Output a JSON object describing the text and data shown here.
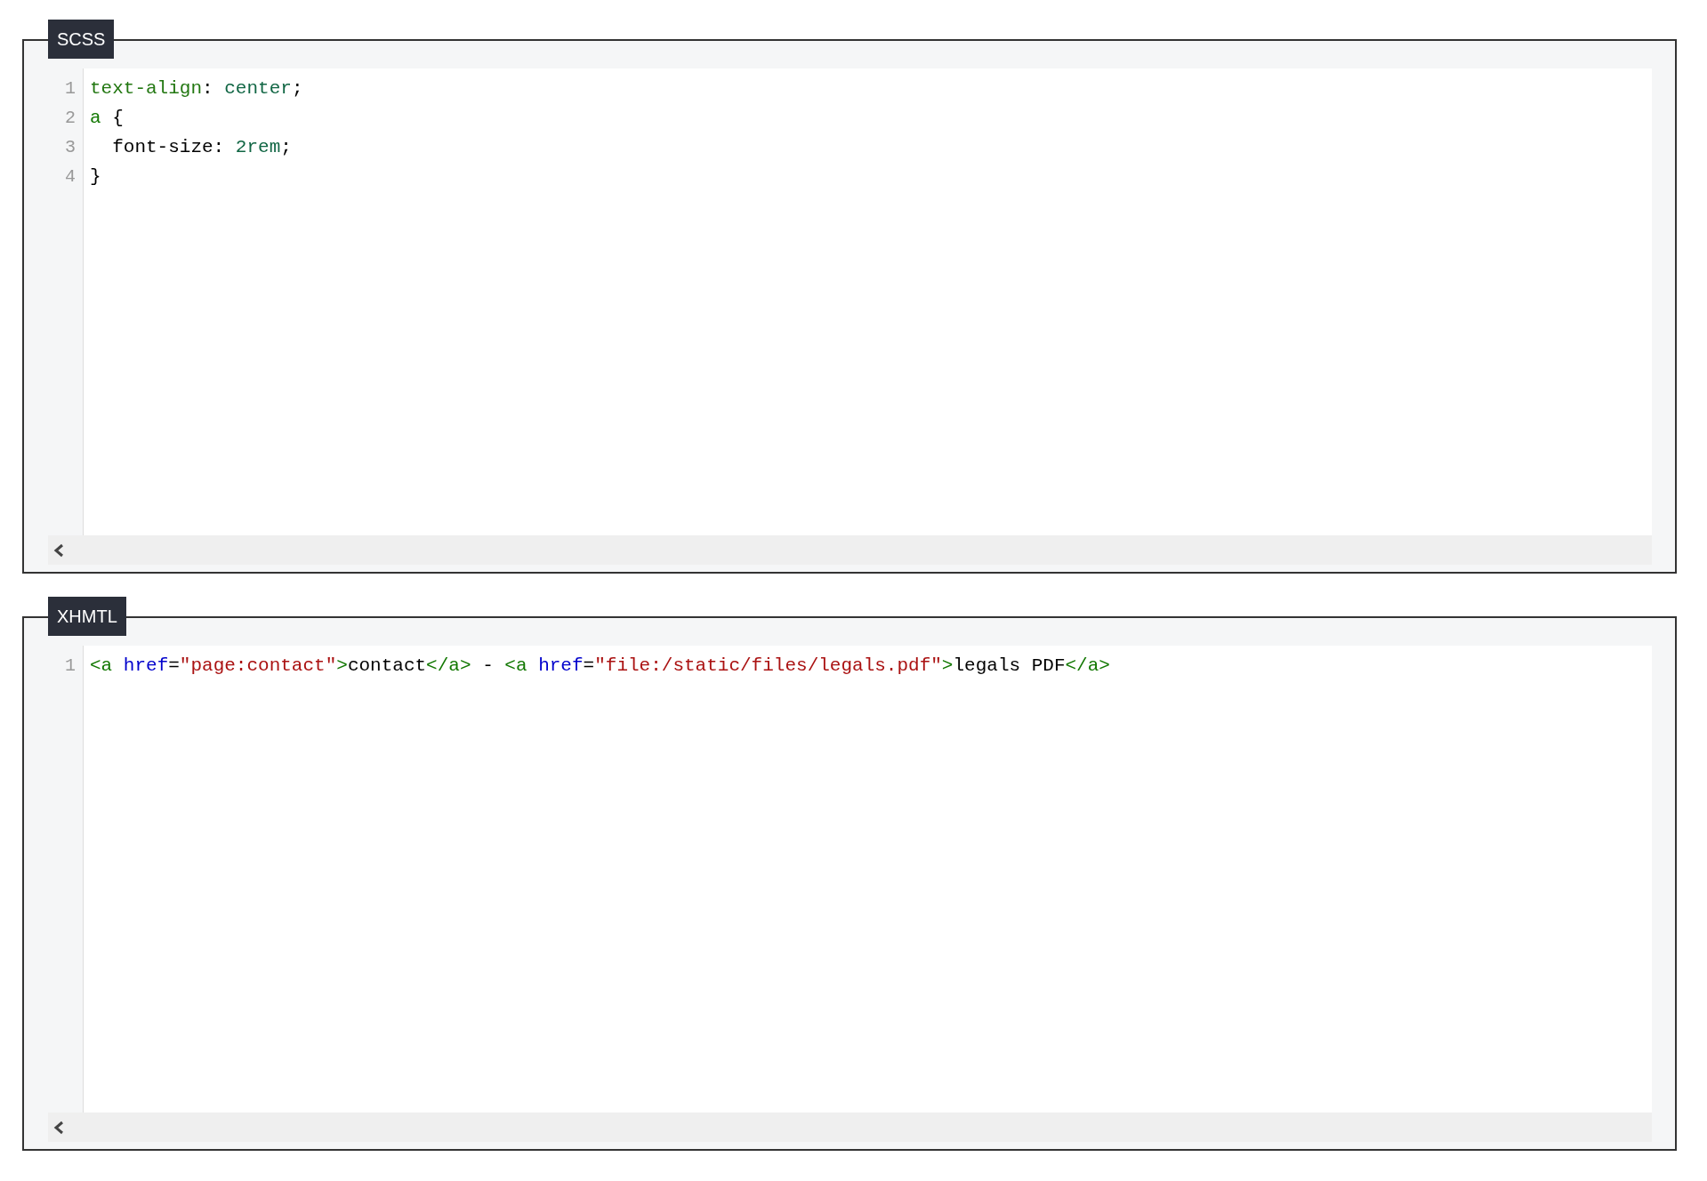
{
  "panels": [
    {
      "label": "SCSS",
      "lines": [
        {
          "number": "1",
          "tokens": [
            {
              "kind": "property",
              "text": "text-align"
            },
            {
              "kind": "plain",
              "text": ": "
            },
            {
              "kind": "value",
              "text": "center"
            },
            {
              "kind": "plain",
              "text": ";"
            }
          ]
        },
        {
          "number": "2",
          "tokens": [
            {
              "kind": "tag",
              "text": "a"
            },
            {
              "kind": "plain",
              "text": " {"
            }
          ]
        },
        {
          "number": "3",
          "tokens": [
            {
              "kind": "plain",
              "text": "  font-size: "
            },
            {
              "kind": "value",
              "text": "2rem"
            },
            {
              "kind": "plain",
              "text": ";"
            }
          ]
        },
        {
          "number": "4",
          "tokens": [
            {
              "kind": "plain",
              "text": "}"
            }
          ]
        }
      ]
    },
    {
      "label": "XHMTL",
      "lines": [
        {
          "number": "1",
          "tokens": [
            {
              "kind": "tag",
              "text": "<a"
            },
            {
              "kind": "attribute",
              "text": " href"
            },
            {
              "kind": "plain",
              "text": "="
            },
            {
              "kind": "string",
              "text": "\"page:contact\""
            },
            {
              "kind": "tag",
              "text": ">"
            },
            {
              "kind": "plain",
              "text": "contact"
            },
            {
              "kind": "tag",
              "text": "</a>"
            },
            {
              "kind": "plain",
              "text": " - "
            },
            {
              "kind": "tag",
              "text": "<a"
            },
            {
              "kind": "attribute",
              "text": " href"
            },
            {
              "kind": "plain",
              "text": "="
            },
            {
              "kind": "string",
              "text": "\"file:/static/files/legals.pdf\""
            },
            {
              "kind": "tag",
              "text": ">"
            },
            {
              "kind": "plain",
              "text": "legals PDF"
            },
            {
              "kind": "tag",
              "text": "</a>"
            }
          ]
        }
      ]
    }
  ]
}
